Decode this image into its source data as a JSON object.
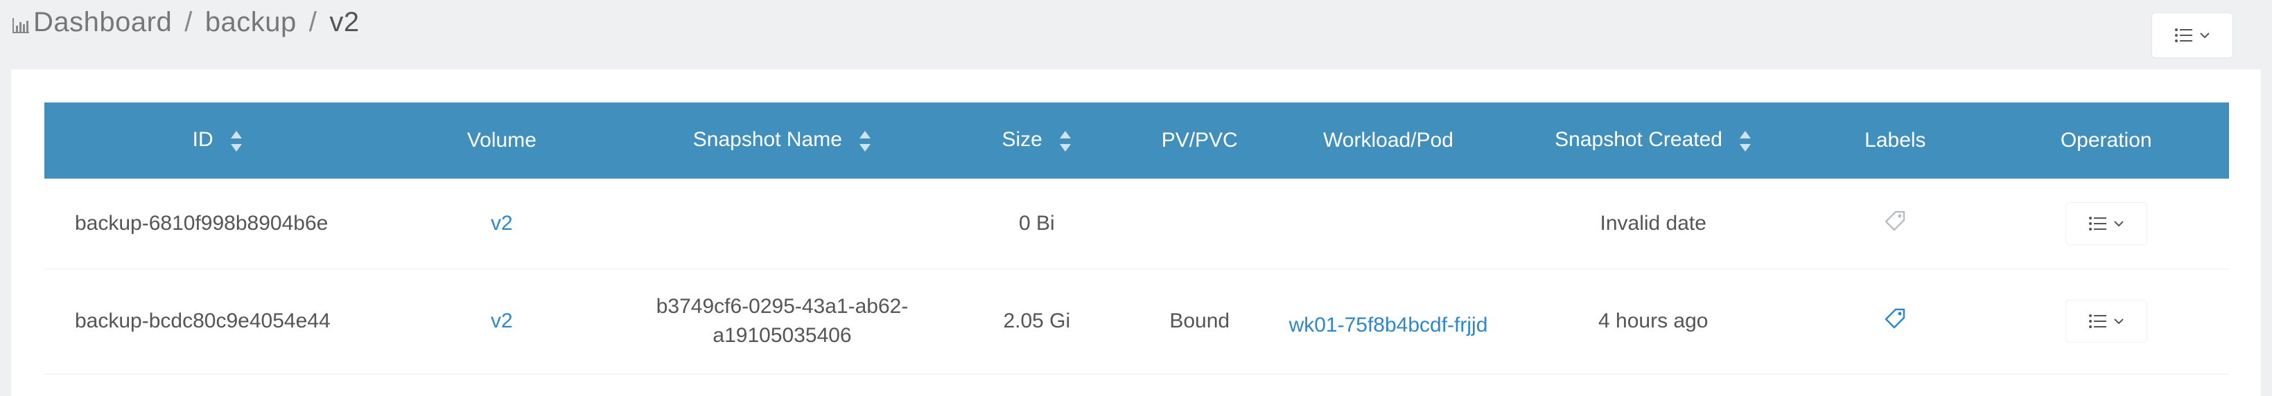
{
  "breadcrumb": {
    "items": [
      "Dashboard",
      "backup",
      "v2"
    ],
    "separator": "/"
  },
  "table": {
    "headers": {
      "id": "ID",
      "volume": "Volume",
      "snapshot_name": "Snapshot Name",
      "size": "Size",
      "pv_pvc": "PV/PVC",
      "workload": "Workload/Pod",
      "created": "Snapshot Created",
      "labels": "Labels",
      "operation": "Operation"
    },
    "rows": [
      {
        "id": "backup-6810f998b8904b6e",
        "volume": "v2",
        "snapshot_line1": "",
        "snapshot_line2": "",
        "size": "0 Bi",
        "pv_pvc": "",
        "workload": "",
        "created": "Invalid date",
        "label_icon": "tag-icon-inactive"
      },
      {
        "id": "backup-bcdc80c9e4054e44",
        "volume": "v2",
        "snapshot_line1": "b3749cf6-0295-43a1-ab62-",
        "snapshot_line2": "a19105035406",
        "size": "2.05 Gi",
        "pv_pvc": "Bound",
        "workload": "wk01-75f8b4bcdf-frjjd",
        "created": "4 hours ago",
        "label_icon": "tag-icon-active"
      }
    ]
  },
  "colors": {
    "header_bg": "#418fbc",
    "link": "#2d88c9",
    "page_bg": "#eef0f2"
  }
}
